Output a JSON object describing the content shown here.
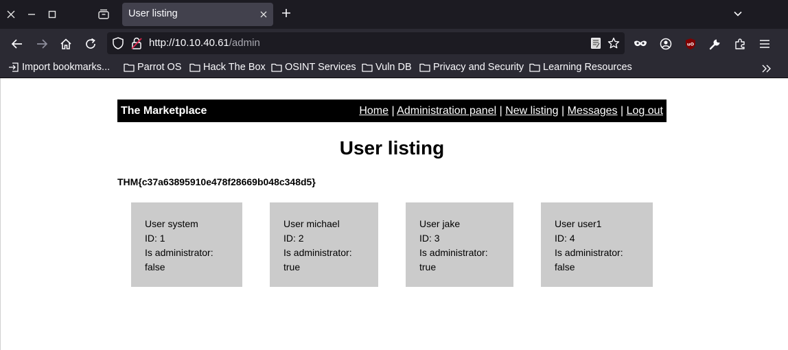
{
  "browser": {
    "tab": {
      "title": "User listing"
    },
    "url": {
      "host": "http://10.10.40.61",
      "path": "/admin"
    },
    "bookmarks": [
      {
        "label": "Import bookmarks..."
      },
      {
        "label": "Parrot OS"
      },
      {
        "label": "Hack The Box"
      },
      {
        "label": "OSINT Services"
      },
      {
        "label": "Vuln DB"
      },
      {
        "label": "Privacy and Security"
      },
      {
        "label": "Learning Resources"
      }
    ]
  },
  "site": {
    "brand": "The Marketplace",
    "nav": [
      {
        "label": "Home"
      },
      {
        "label": "Administration panel"
      },
      {
        "label": "New listing"
      },
      {
        "label": "Messages"
      },
      {
        "label": "Log out"
      }
    ],
    "separator": "|"
  },
  "main": {
    "title": "User listing",
    "flag": "THM{c37a63895910e478f28669b048c348d5}",
    "users": [
      {
        "name": "User system",
        "id": "ID: 1",
        "admin_label": "Is administrator:",
        "admin_value": "false"
      },
      {
        "name": "User michael",
        "id": "ID: 2",
        "admin_label": "Is administrator:",
        "admin_value": "true"
      },
      {
        "name": "User jake",
        "id": "ID: 3",
        "admin_label": "Is administrator:",
        "admin_value": "true"
      },
      {
        "name": "User user1",
        "id": "ID: 4",
        "admin_label": "Is administrator:",
        "admin_value": "false"
      }
    ]
  }
}
